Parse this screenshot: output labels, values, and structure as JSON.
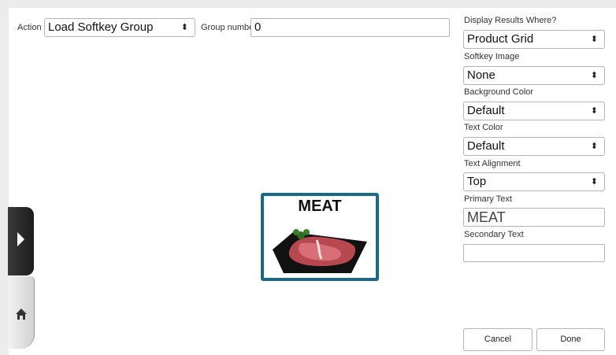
{
  "left": {
    "action_label": "Action",
    "action_value": "Load Softkey Group",
    "group_number_label": "Group number",
    "group_number_value": "0"
  },
  "preview": {
    "primary_text": "MEAT",
    "border_color": "#186a86"
  },
  "right": {
    "display_results_label": "Display Results Where?",
    "display_results_value": "Product Grid",
    "softkey_image_label": "Softkey Image",
    "softkey_image_value": "None",
    "background_color_label": "Background Color",
    "background_color_value": "Default",
    "text_color_label": "Text Color",
    "text_color_value": "Default",
    "text_alignment_label": "Text Alignment",
    "text_alignment_value": "Top",
    "primary_text_label": "Primary Text",
    "primary_text_value": "MEAT",
    "secondary_text_label": "Secondary Text",
    "secondary_text_value": ""
  },
  "buttons": {
    "cancel": "Cancel",
    "done": "Done"
  },
  "icons": {
    "select_arrow": "⬍",
    "side_expand": "play-icon",
    "side_home": "home-icon"
  }
}
